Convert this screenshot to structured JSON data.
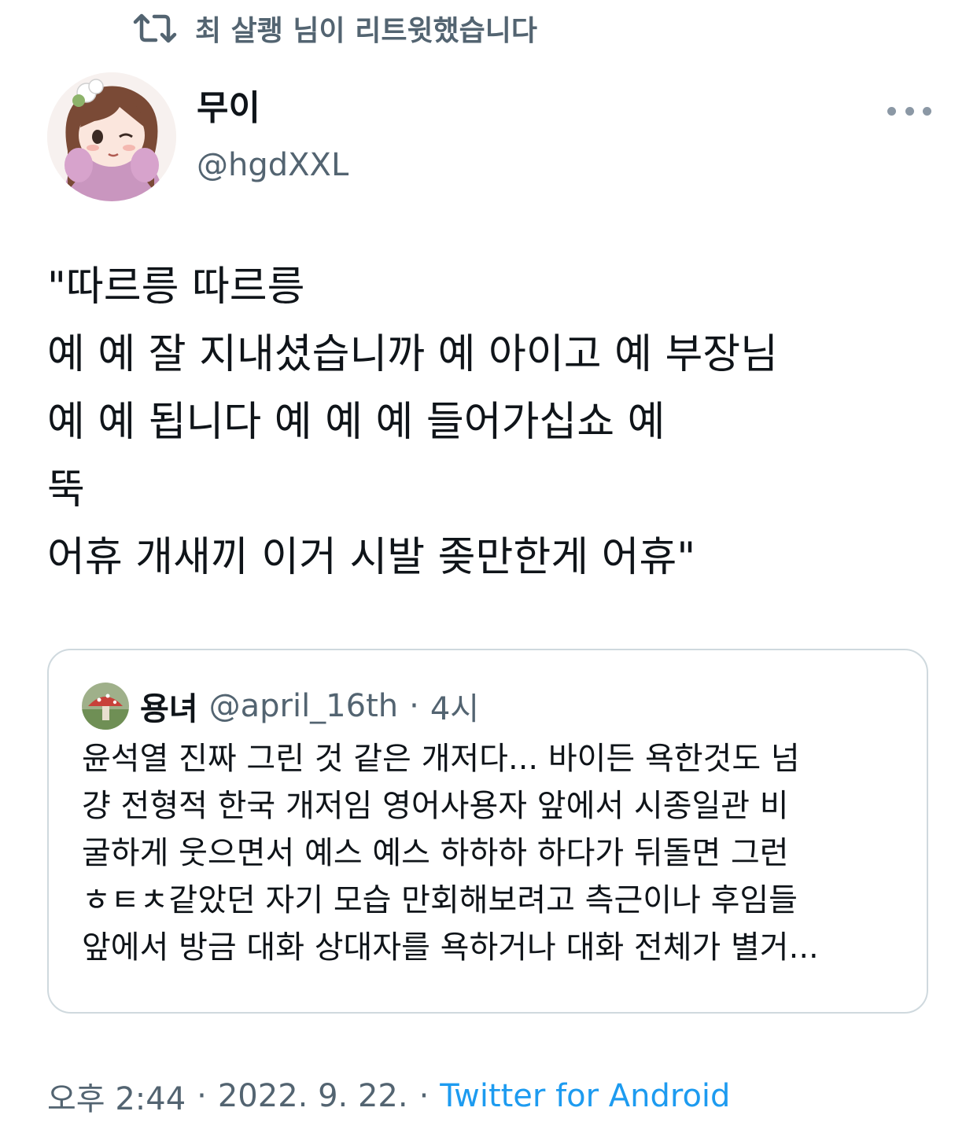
{
  "social_context": {
    "icon": "retweet-icon",
    "text": "최 살쾡 님이 리트윗했습니다"
  },
  "author": {
    "display_name": "무이",
    "handle": "@hgdXXL",
    "avatar_icon": "anime-girl-avatar"
  },
  "more_menu_icon": "more-options-icon",
  "tweet": {
    "text": "\"따르릉 따르릉\n예 예 잘 지내셨습니까 예 아이고 예 부장님\n예 예 됩니다 예 예 예 들어가십쇼 예\n뚝\n어휴 개새끼 이거 시발 좆만한게 어휴\""
  },
  "quoted_tweet": {
    "display_name": "용녀",
    "handle": "@april_16th",
    "separator": "·",
    "time": "4시",
    "text": "윤석열 진짜 그린 것 같은 개저다... 바이든 욕한것도 넘\n걍 전형적 한국 개저임 영어사용자 앞에서 시종일관 비\n굴하게 웃으면서 예스 예스 하하하 하다가 뒤돌면 그런\nㅎㅌㅊ같았던 자기 모습 만회해보려고 측근이나 후임들\n앞에서 방금 대화 상대자를 욕하거나 대화 전체가 별거..."
  },
  "footer": {
    "time": "오후 2:44",
    "dot1": "·",
    "date": "2022. 9. 22.",
    "dot2": "·",
    "source": "Twitter for Android"
  },
  "colors": {
    "text_primary": "#0f1419",
    "text_secondary": "#536471",
    "link": "#1d9bf0",
    "border": "#cfd9de"
  }
}
